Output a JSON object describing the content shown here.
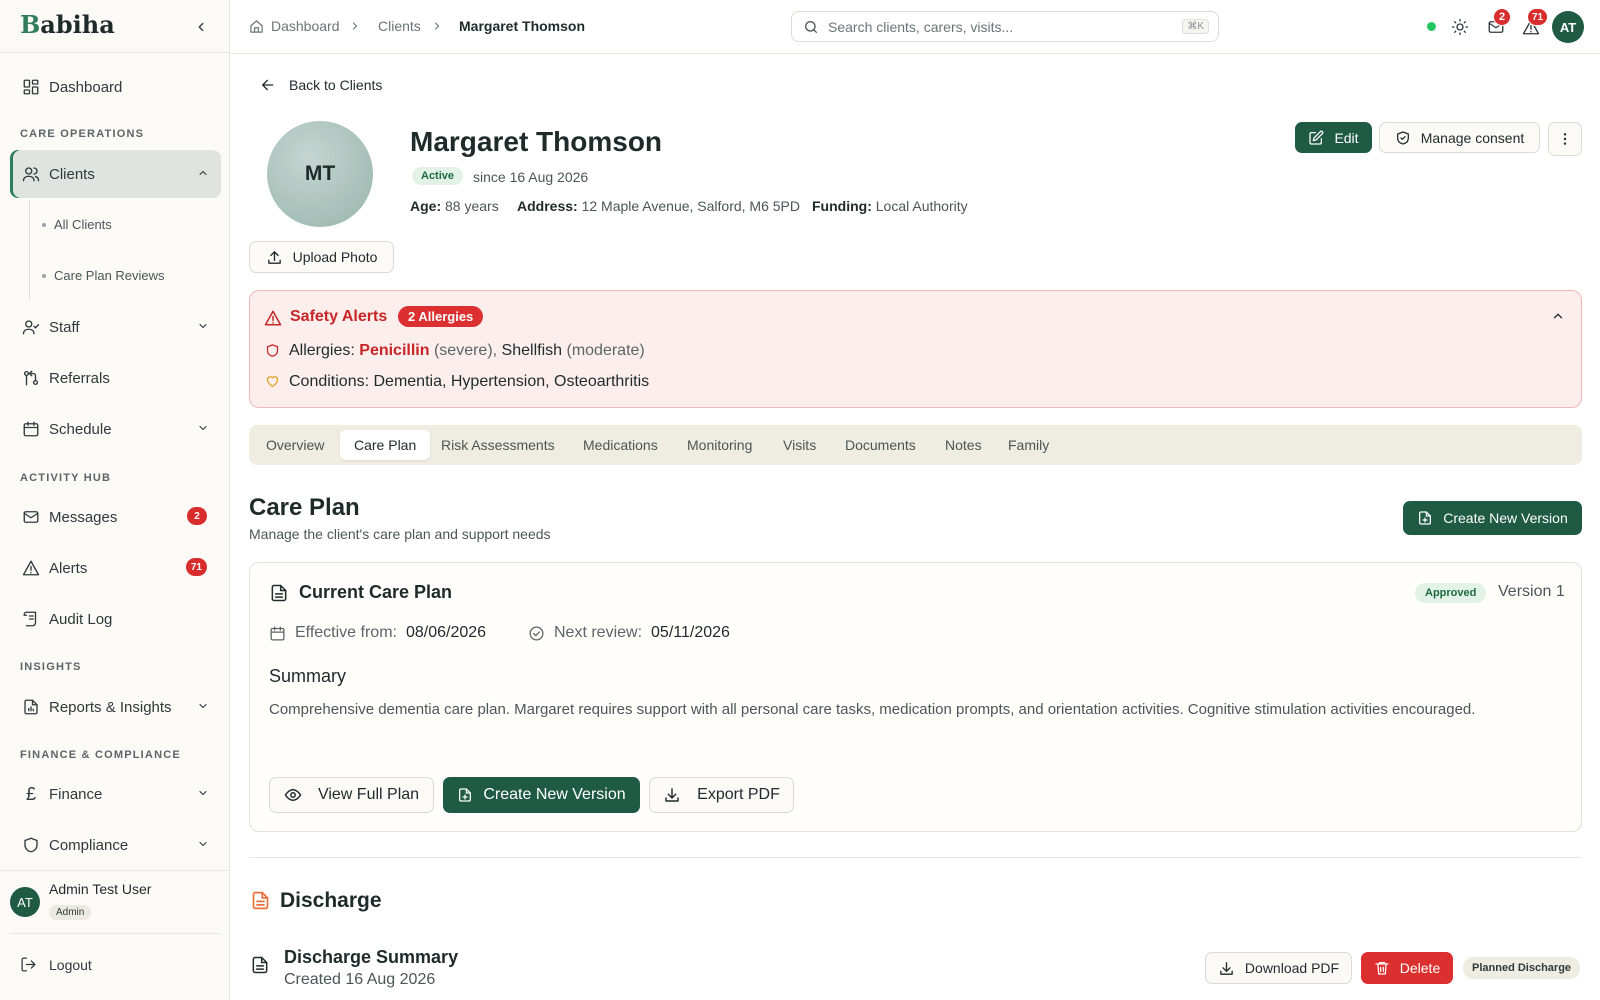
{
  "app": {
    "brand_first": "B",
    "brand_rest": "abiha",
    "accent_color": "#1e5a44",
    "danger_color": "#dc2f2f"
  },
  "sidebar": {
    "dashboard": "Dashboard",
    "sections": {
      "care_operations": "CARE OPERATIONS",
      "activity_hub": "ACTIVITY HUB",
      "insights": "INSIGHTS",
      "finance_compliance": "FINANCE & COMPLIANCE"
    },
    "clients": "Clients",
    "clients_sub": [
      "All Clients",
      "Care Plan Reviews"
    ],
    "staff": "Staff",
    "referrals": "Referrals",
    "schedule": "Schedule",
    "messages": "Messages",
    "messages_badge": "2",
    "alerts": "Alerts",
    "alerts_badge": "71",
    "audit_log": "Audit Log",
    "reports": "Reports & Insights",
    "finance": "Finance",
    "compliance": "Compliance",
    "user": {
      "initials": "AT",
      "name": "Admin Test User",
      "role": "Admin"
    },
    "logout": "Logout"
  },
  "topbar": {
    "breadcrumb": [
      "Dashboard",
      "Clients",
      "Margaret Thomson"
    ],
    "search_placeholder": "Search clients, carers, visits...",
    "search_shortcut": "⌘K",
    "messages_badge": "2",
    "alerts_badge": "71",
    "user_initials": "AT"
  },
  "client": {
    "back_label": "Back to Clients",
    "initials": "MT",
    "name": "Margaret Thomson",
    "status": "Active",
    "since": "since 16 Aug 2026",
    "age_label": "Age:",
    "age": "88 years",
    "address_label": "Address:",
    "address": "12 Maple Avenue, Salford, M6 5PD",
    "funding_label": "Funding:",
    "funding": "Local Authority",
    "upload_photo": "Upload Photo",
    "edit": "Edit",
    "manage_consent": "Manage consent"
  },
  "safety": {
    "title": "Safety Alerts",
    "badge": "2 Allergies",
    "allergies_label": "Allergies:",
    "allergy_1": "Penicillin",
    "allergy_1_sev": "(severe),",
    "allergy_2": "Shellfish",
    "allergy_2_sev": "(moderate)",
    "conditions_label": "Conditions:",
    "conditions": "Dementia, Hypertension, Osteoarthritis"
  },
  "tabs": [
    "Overview",
    "Care Plan",
    "Risk Assessments",
    "Medications",
    "Monitoring",
    "Visits",
    "Documents",
    "Notes",
    "Family"
  ],
  "care_plan": {
    "heading": "Care Plan",
    "subheading": "Manage the client's care plan and support needs",
    "create_new_version": "Create New Version",
    "card_title": "Current Care Plan",
    "status": "Approved",
    "version": "Version 1",
    "effective_label": "Effective from:",
    "effective_date": "08/06/2026",
    "review_label": "Next review:",
    "review_date": "05/11/2026",
    "summary_heading": "Summary",
    "summary_text": "Comprehensive dementia care plan. Margaret requires support with all personal care tasks, medication prompts, and orientation activities. Cognitive stimulation activities encouraged.",
    "view_full_plan": "View Full Plan",
    "export_pdf": "Export PDF"
  },
  "discharge": {
    "heading": "Discharge",
    "summary_title": "Discharge Summary",
    "created": "Created 16 Aug 2026",
    "download_pdf": "Download PDF",
    "delete": "Delete",
    "status": "Planned Discharge"
  }
}
